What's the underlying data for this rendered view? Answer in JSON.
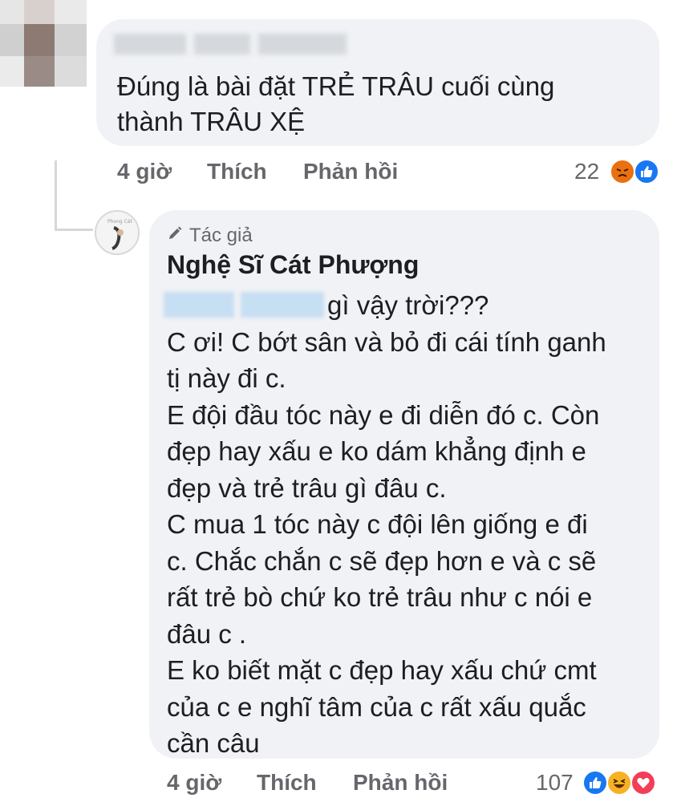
{
  "top_comment": {
    "text_lines": [
      "Đúng là bài đặt TRẺ TRÂU cuối cùng",
      "thành TRÂU XỆ"
    ],
    "time": "4 giờ",
    "like_label": "Thích",
    "reply_label": "Phản hồi",
    "reaction_count": "22",
    "reactions": [
      "angry-reaction-icon",
      "like-reaction-icon"
    ]
  },
  "reply": {
    "author_badge": "Tác giả",
    "author_name": "Nghệ Sĩ Cát Phượng",
    "text_lines": [
      "gì vậy trời???",
      "C ơi! C bớt sân và bỏ đi cái tính ganh",
      "tị này đi c.",
      "E đội đầu tóc này e đi diễn đó c. Còn",
      "đẹp hay xấu e ko dám khẳng định e",
      "đẹp và trẻ trâu gì đâu c.",
      "C mua 1 tóc này c đội lên giống e đi",
      "c. Chắc chắn c sẽ đẹp hơn e và c sẽ",
      "rất trẻ bò chứ ko trẻ trâu như c nói e",
      "đâu c .",
      "E ko biết mặt c đẹp hay xấu chứ cmt",
      "của c e nghĩ tâm của c rất xấu quắc",
      "cần câu"
    ],
    "time": "4 giờ",
    "like_label": "Thích",
    "reply_label": "Phản hồi",
    "reaction_count": "107",
    "reactions": [
      "like-reaction-icon",
      "haha-reaction-icon",
      "love-reaction-icon"
    ]
  },
  "colors": {
    "bubble": "#f0f2f5",
    "meta_text": "#65676b",
    "like_blue": "#1877f2",
    "angry_orange": "#e9710f",
    "love_red": "#f33e58",
    "haha_yellow": "#f7b125"
  }
}
